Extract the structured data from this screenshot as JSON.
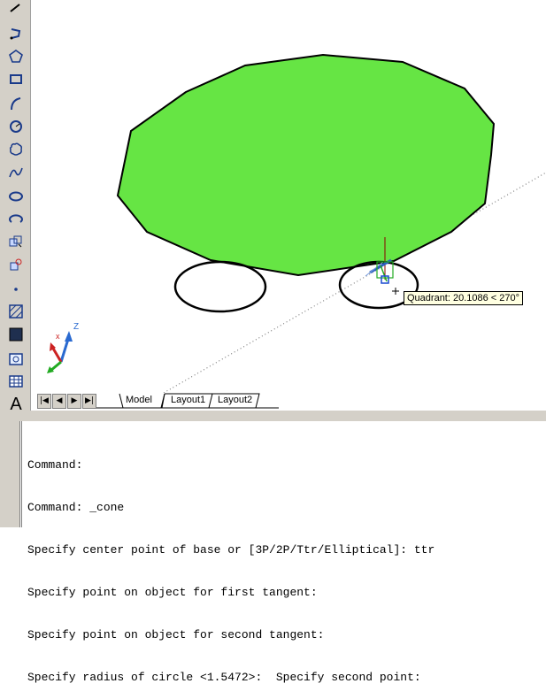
{
  "toolbar": {
    "tools": [
      {
        "name": "line-icon"
      },
      {
        "name": "polyline-icon"
      },
      {
        "name": "polygon-icon"
      },
      {
        "name": "rectangle-icon"
      },
      {
        "name": "arc-icon"
      },
      {
        "name": "circle-icon"
      },
      {
        "name": "revision-cloud-icon"
      },
      {
        "name": "spline-icon"
      },
      {
        "name": "ellipse-icon"
      },
      {
        "name": "ellipse-arc-icon"
      },
      {
        "name": "insert-block-icon"
      },
      {
        "name": "make-block-icon"
      },
      {
        "name": "point-icon"
      },
      {
        "name": "hatch-icon"
      },
      {
        "name": "gradient-icon"
      },
      {
        "name": "region-icon"
      },
      {
        "name": "table-icon"
      }
    ],
    "text_tool": "A"
  },
  "viewport": {
    "ucs": {
      "z_label": "Z"
    },
    "tooltip": "Quadrant: 20.1086 < 270°",
    "colors": {
      "polygon_fill": "#66e544",
      "outline": "#000000"
    }
  },
  "tabs": {
    "nav": [
      "|◀",
      "◀",
      "▶",
      "▶|"
    ],
    "items": [
      "Model",
      "Layout1",
      "Layout2"
    ],
    "active": "Model"
  },
  "command": {
    "lines": [
      "Command:",
      "Command: _cone",
      "Specify center point of base or [3P/2P/Ttr/Elliptical]: ttr",
      "Specify point on object for first tangent:",
      "Specify point on object for second tangent:",
      "Specify radius of circle <1.5472>:  Specify second point:"
    ]
  }
}
